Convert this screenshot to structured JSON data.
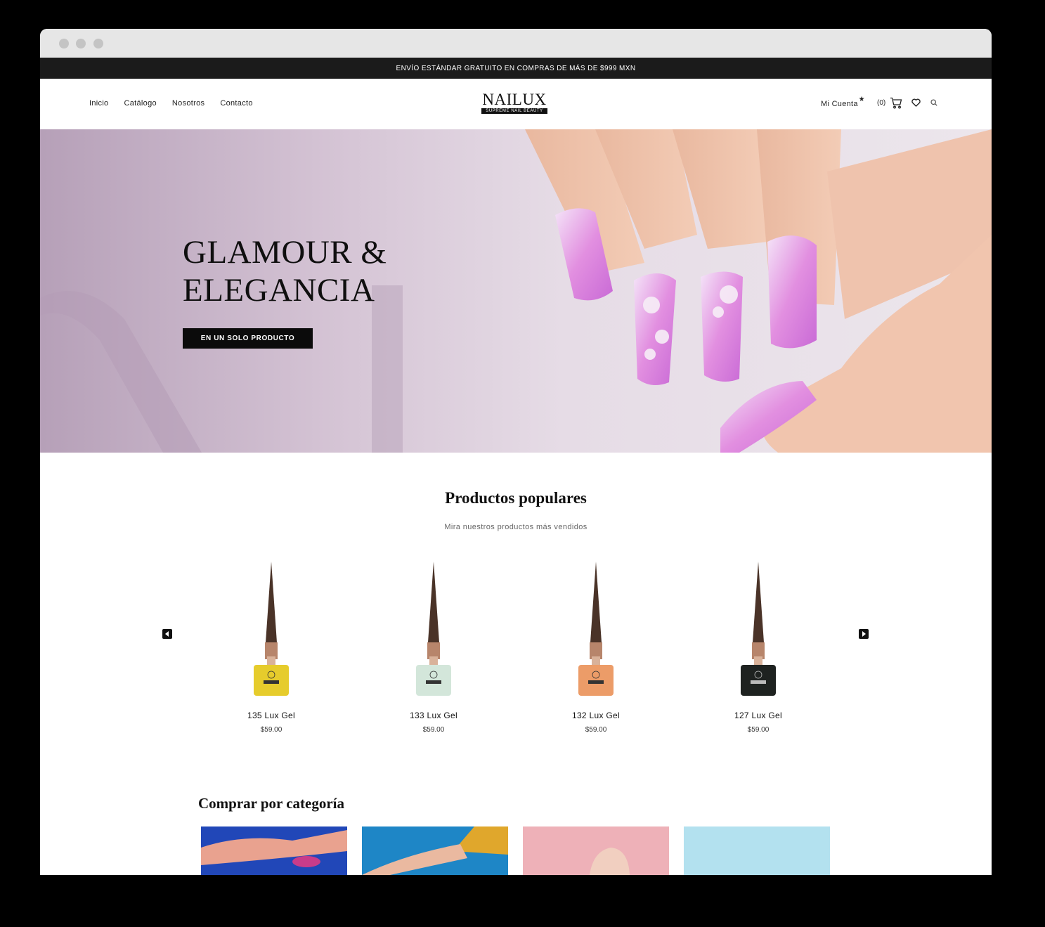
{
  "promo_bar": {
    "text": "ENVÍO ESTÁNDAR GRATUITO EN COMPRAS DE MÁS DE $999 MXN"
  },
  "nav": {
    "items": [
      {
        "label": "Inicio"
      },
      {
        "label": "Catálogo"
      },
      {
        "label": "Nosotros"
      },
      {
        "label": "Contacto"
      }
    ]
  },
  "logo": {
    "brand": "NAILUX",
    "tagline": "SUPREME NAIL BEAUTY"
  },
  "header": {
    "account_label": "Mi Cuenta",
    "account_star": "★",
    "cart_count": "(0)",
    "icons": [
      "cart-icon",
      "heart-icon",
      "search-icon"
    ]
  },
  "hero": {
    "title_line1": "GLAMOUR &",
    "title_line2": "ELEGANCIA",
    "button_label": "EN UN SOLO PRODUCTO"
  },
  "popular": {
    "title": "Productos populares",
    "subtitle": "Mira nuestros productos más vendidos",
    "products": [
      {
        "name": "135 Lux Gel",
        "price": "$59.00",
        "color": "#e6cc2c"
      },
      {
        "name": "133 Lux Gel",
        "price": "$59.00",
        "color": "#d3e6da"
      },
      {
        "name": "132 Lux Gel",
        "price": "$59.00",
        "color": "#ec9c68"
      },
      {
        "name": "127 Lux Gel",
        "price": "$59.00",
        "color": "#1e2220"
      }
    ]
  },
  "categories": {
    "title": "Comprar por categoría"
  },
  "colors": {
    "promo_bg": "#1b1b1b",
    "button_bg": "#0b0b0b",
    "hero_tint": "#d4c3d4"
  }
}
